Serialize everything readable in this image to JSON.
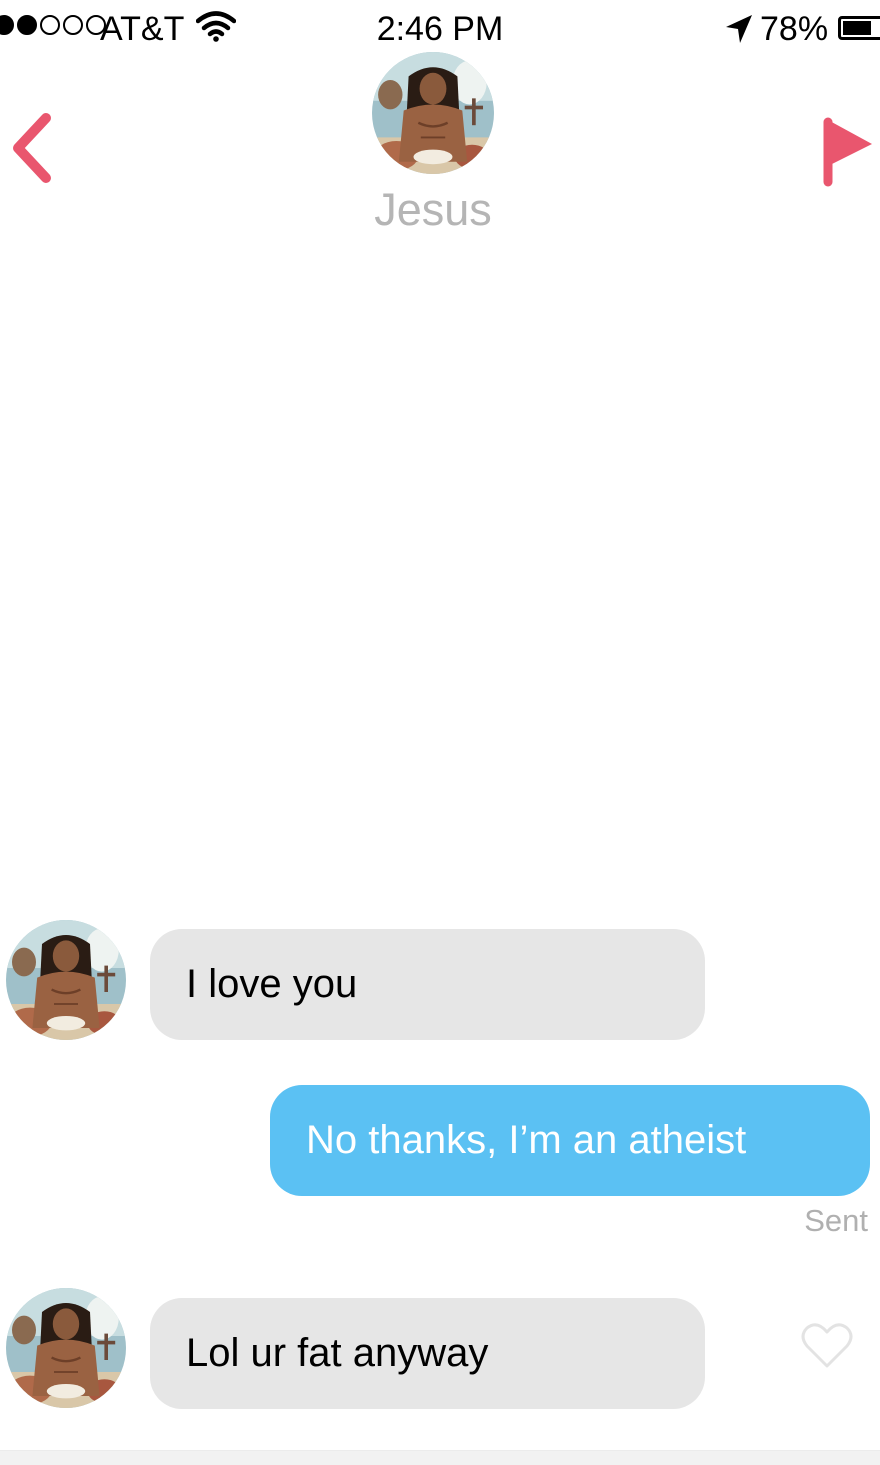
{
  "status_bar": {
    "carrier": "AT&T",
    "time": "2:46 PM",
    "battery_percent": "78%",
    "signal_bars_filled": 2,
    "signal_bars_total": 5,
    "icons": [
      "wifi-icon",
      "location-arrow-icon",
      "battery-icon"
    ]
  },
  "header": {
    "contact_name": "Jesus",
    "back_icon": "chevron-left-icon",
    "report_icon": "flag-icon",
    "accent_color": "#e9566e"
  },
  "messages": [
    {
      "direction": "incoming",
      "text": "I love you"
    },
    {
      "direction": "outgoing",
      "text": "No thanks, I’m an atheist",
      "status": "Sent"
    },
    {
      "direction": "incoming",
      "text": "Lol ur fat anyway",
      "like_icon": "heart-outline-icon"
    }
  ],
  "colors": {
    "incoming_bubble": "#e6e6e6",
    "outgoing_bubble": "#5bc1f3",
    "contact_name": "#b5b5b5",
    "status_text": "#b0b0b0"
  }
}
